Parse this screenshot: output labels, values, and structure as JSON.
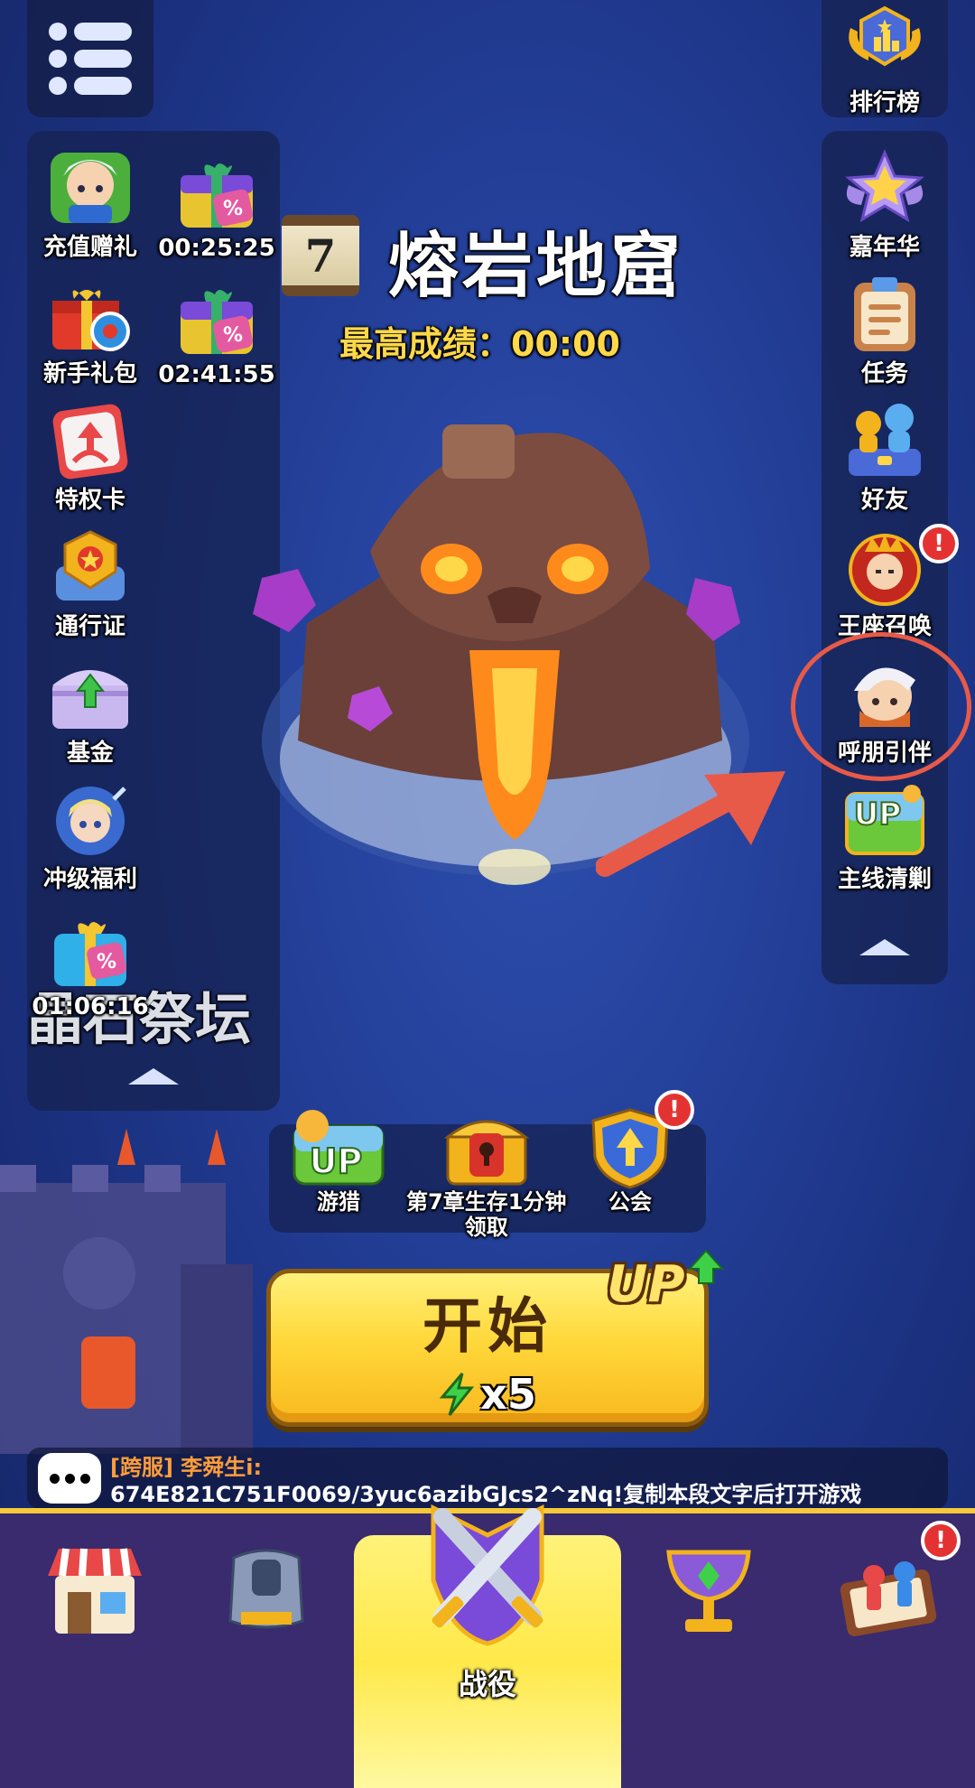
{
  "left_sidebar": {
    "items": [
      {
        "label": "充值赠礼",
        "icon": "hero-portrait-icon"
      },
      {
        "label": "00:25:25",
        "icon": "discount-gift-icon"
      },
      {
        "label": "新手礼包",
        "icon": "red-gift-box-icon"
      },
      {
        "label": "02:41:55",
        "icon": "discount-gift-icon"
      },
      {
        "label": "特权卡",
        "icon": "privilege-card-icon"
      },
      {
        "label": "通行证",
        "icon": "battle-pass-badge-icon"
      },
      {
        "label": "基金",
        "icon": "fund-chest-icon"
      },
      {
        "label": "冲级福利",
        "icon": "angel-hero-icon"
      },
      {
        "label": "01:06:16",
        "icon": "discount-gift-icon"
      }
    ],
    "overlay_text": "晶石祭坛"
  },
  "right_sidebar": {
    "leaderboard": {
      "label": "排行榜",
      "icon": "trophy-crown-icon"
    },
    "items": [
      {
        "label": "嘉年华",
        "icon": "star-icon"
      },
      {
        "label": "任务",
        "icon": "clipboard-icon"
      },
      {
        "label": "好友",
        "icon": "friends-icon"
      },
      {
        "label": "王座召唤",
        "icon": "king-portrait-icon",
        "badge": "!"
      },
      {
        "label": "呼朋引伴",
        "icon": "invite-hero-icon"
      },
      {
        "label": "主线清剿",
        "icon": "up-landscape-icon"
      }
    ]
  },
  "stage": {
    "chapter_number": "7",
    "title": "熔岩地窟",
    "best_score": "最高成绩：00:00"
  },
  "activities": [
    {
      "label": "游猎",
      "icon": "up-hunt-icon"
    },
    {
      "label": "第7章生存1分钟\n领取",
      "icon": "locked-chest-icon"
    },
    {
      "label": "公会",
      "icon": "guild-shield-icon",
      "badge": "!"
    }
  ],
  "start_button": {
    "label": "开始",
    "energy_cost": "x5",
    "up_tag": "UP"
  },
  "chat": {
    "sender": "[跨服] 李舜生i:",
    "message": "674E821C751F0069/3yuc6azibGJcs2^zNq!复制本段文字后打开游戏"
  },
  "bottom_nav": {
    "tabs": [
      {
        "icon": "shop-icon"
      },
      {
        "icon": "armor-icon"
      },
      {
        "icon": "crossed-swords-icon",
        "label": "战役",
        "active": true
      },
      {
        "icon": "goblet-icon"
      },
      {
        "icon": "board-game-icon",
        "badge": "!"
      }
    ]
  },
  "colors": {
    "accent_yellow": "#ffd83b",
    "score_yellow": "#ffd84a",
    "badge_red": "#e43232",
    "highlight_red": "#e85a48",
    "nav_purple": "#3a2a6e"
  }
}
